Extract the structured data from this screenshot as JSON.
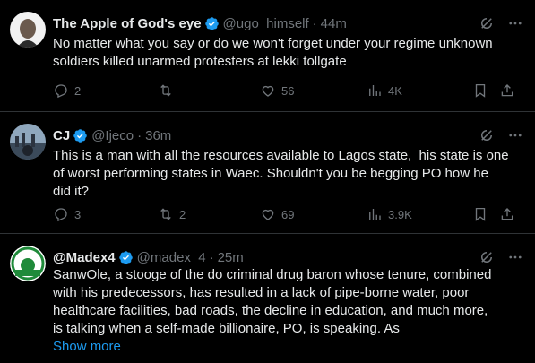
{
  "tweets": [
    {
      "name": "The Apple of God's eye",
      "handle": "@ugo_himself",
      "time": "44m",
      "text": "No matter what you say or do we won't forget under your regime unknown\nsoldiers killed unarmed protesters at lekki tollgate",
      "replies": "2",
      "retweets": "",
      "likes": "56",
      "views": "4K",
      "avatar_color": "#f2f2f2"
    },
    {
      "name": "CJ",
      "handle": "@Ijeco",
      "time": "36m",
      "text": "This is a man with all the resources available to Lagos state,  his state is one\nof worst performing states in Waec. Shouldn't you be begging PO how he\ndid it?",
      "replies": "3",
      "retweets": "2",
      "likes": "69",
      "views": "3.9K",
      "avatar_color": "#3b4a5a"
    },
    {
      "name": "@Madex4",
      "handle": "@madex_4",
      "time": "25m",
      "text": "SanwOle, a stooge of the do criminal drug baron whose tenure, combined\nwith his predecessors, has resulted in a lack of pipe-borne water, poor\nhealthcare facilities, bad roads, the decline in education, and much more,\nis talking when a self-made billionaire, PO, is speaking. As",
      "show_more": "Show more",
      "avatar_color": "#1f8a3a"
    }
  ],
  "icons": [
    "verified-badge-icon",
    "grok-icon",
    "more-icon",
    "reply-icon",
    "retweet-icon",
    "like-icon",
    "views-icon",
    "bookmark-icon",
    "share-icon"
  ],
  "colors": {
    "background": "#000000",
    "text": "#e7e9ea",
    "muted": "#71767b",
    "accent": "#1d9bf0",
    "border": "#2f3336"
  }
}
